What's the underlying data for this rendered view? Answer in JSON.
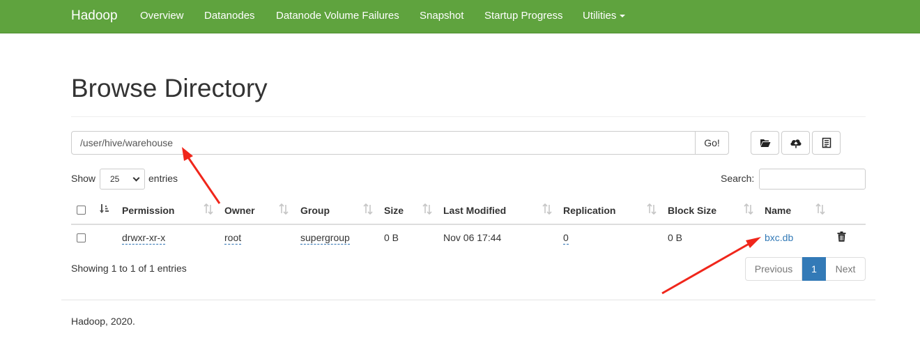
{
  "navbar": {
    "brand": "Hadoop",
    "items": [
      "Overview",
      "Datanodes",
      "Datanode Volume Failures",
      "Snapshot",
      "Startup Progress",
      "Utilities"
    ],
    "background": "#5fa33e"
  },
  "page": {
    "title": "Browse Directory"
  },
  "path_bar": {
    "value": "/user/hive/warehouse",
    "go_label": "Go!"
  },
  "toolbar": {
    "icons": [
      "folder-open-icon",
      "cloud-upload-icon",
      "clipboard-icon"
    ]
  },
  "length_control": {
    "prefix": "Show",
    "selected": "25",
    "suffix": "entries"
  },
  "search": {
    "label": "Search:",
    "value": ""
  },
  "table": {
    "columns": [
      "Permission",
      "Owner",
      "Group",
      "Size",
      "Last Modified",
      "Replication",
      "Block Size",
      "Name"
    ],
    "rows": [
      {
        "permission": "drwxr-xr-x",
        "owner": "root",
        "group": "supergroup",
        "size": "0 B",
        "last_modified": "Nov 06 17:44",
        "replication": "0",
        "block_size": "0 B",
        "name": "bxc.db"
      }
    ],
    "info": "Showing 1 to 1 of 1 entries"
  },
  "pagination": {
    "previous": "Previous",
    "current": "1",
    "next": "Next",
    "active_color": "#337ab7"
  },
  "footer": {
    "text": "Hadoop, 2020."
  },
  "annotations": {
    "arrow_color": "#f0261b"
  }
}
